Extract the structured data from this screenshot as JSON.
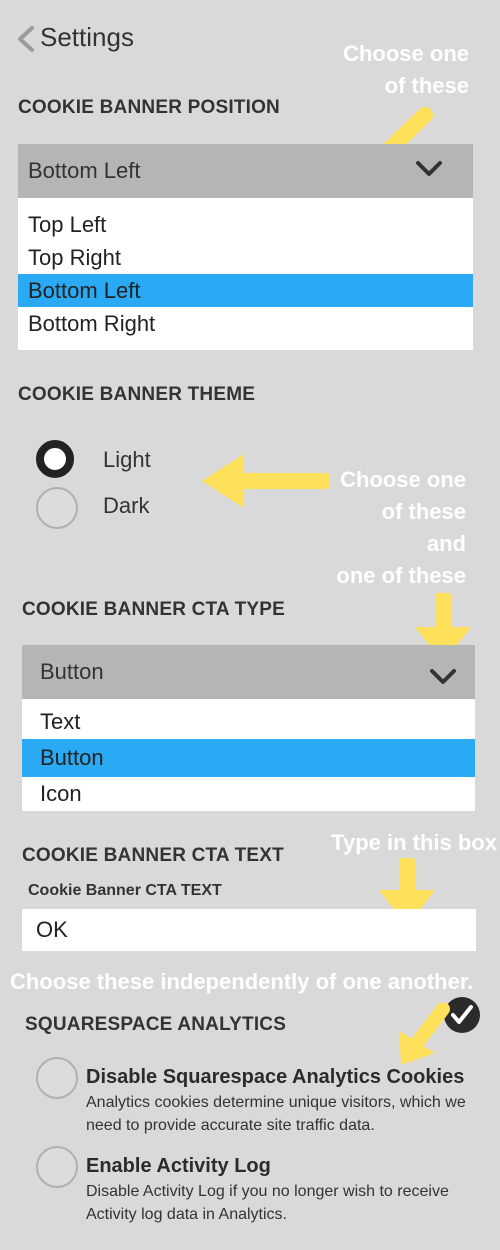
{
  "header": {
    "title": "Settings"
  },
  "position": {
    "heading": "COOKIE BANNER POSITION",
    "selected": "Bottom Left",
    "options": [
      "Top Left",
      "Top Right",
      "Bottom Left",
      "Bottom Right"
    ],
    "selected_index": 2
  },
  "theme": {
    "heading": "COOKIE BANNER THEME",
    "options": [
      "Light",
      "Dark"
    ],
    "selected_index": 0
  },
  "cta_type": {
    "heading": "COOKIE BANNER CTA TYPE",
    "selected": "Button",
    "options": [
      "Text",
      "Button",
      "Icon"
    ],
    "selected_index": 1
  },
  "cta_text": {
    "heading": "COOKIE BANNER CTA TEXT",
    "field_label": "Cookie Banner CTA TEXT",
    "value": "OK"
  },
  "analytics": {
    "heading": "SQUARESPACE ANALYTICS",
    "items": [
      {
        "title": "Disable Squarespace Analytics Cookies",
        "desc_line1": "Analytics cookies determine unique visitors, which we",
        "desc_line2": "need  to provide accurate site traffic data.",
        "checked": false
      },
      {
        "title": "Enable Activity Log",
        "desc_line1": "Disable Activity Log if you no longer wish to receive",
        "desc_line2": "Activity log data in Analytics.",
        "checked": false
      }
    ]
  },
  "annotations": {
    "note1_line1": "Choose one",
    "note1_line2": "of these",
    "note2_line1": "Choose one",
    "note2_line2": "of these",
    "note2_line3": "and",
    "note2_line4": "one of these",
    "note3": "Type in this box",
    "note4": "Choose these independently of one another."
  },
  "colors": {
    "background": "#d9d9d9",
    "select_header": "#b5b5b5",
    "selected_option": "#2aa9f5",
    "annotation_arrow": "#ffe05a",
    "annotation_text": "#ffffff"
  },
  "icons": [
    "back-chevron-icon",
    "chevron-down-icon",
    "check-circle-icon",
    "arrow-icon"
  ]
}
